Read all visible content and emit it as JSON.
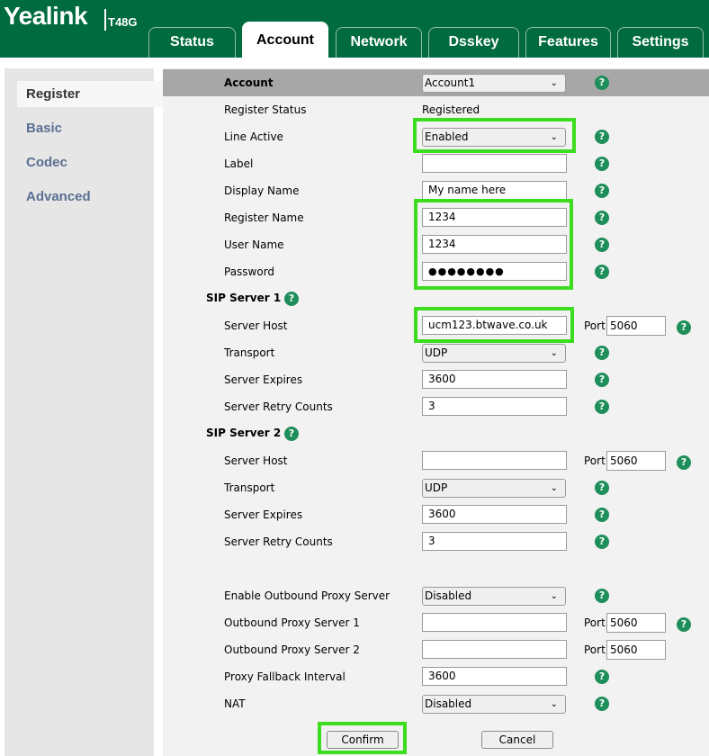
{
  "header": {
    "brand": "Yealink",
    "model": "T48G",
    "tabs": [
      {
        "label": "Status"
      },
      {
        "label": "Account"
      },
      {
        "label": "Network"
      },
      {
        "label": "Dsskey"
      },
      {
        "label": "Features"
      },
      {
        "label": "Settings"
      }
    ],
    "active_tab": "Account"
  },
  "sidebar": {
    "items": [
      {
        "label": "Register"
      },
      {
        "label": "Basic"
      },
      {
        "label": "Codec"
      },
      {
        "label": "Advanced"
      }
    ],
    "active_item": "Register"
  },
  "form": {
    "account": {
      "label": "Account",
      "value": "Account1"
    },
    "register_status": {
      "label": "Register Status",
      "value": "Registered"
    },
    "line_active": {
      "label": "Line Active",
      "value": "Enabled"
    },
    "label": {
      "label": "Label",
      "value": ""
    },
    "display_name": {
      "label": "Display Name",
      "value": "My name here"
    },
    "register_name": {
      "label": "Register Name",
      "value": "1234"
    },
    "user_name": {
      "label": "User Name",
      "value": "1234"
    },
    "password": {
      "label": "Password",
      "value": "●●●●●●●●"
    },
    "sip1": {
      "title": "SIP Server 1",
      "server_host": {
        "label": "Server Host",
        "value": "ucm123.btwave.co.uk"
      },
      "port": {
        "label": "Port",
        "value": "5060"
      },
      "transport": {
        "label": "Transport",
        "value": "UDP"
      },
      "expires": {
        "label": "Server Expires",
        "value": "3600"
      },
      "retry": {
        "label": "Server Retry Counts",
        "value": "3"
      }
    },
    "sip2": {
      "title": "SIP Server 2",
      "server_host": {
        "label": "Server Host",
        "value": ""
      },
      "port": {
        "label": "Port",
        "value": "5060"
      },
      "transport": {
        "label": "Transport",
        "value": "UDP"
      },
      "expires": {
        "label": "Server Expires",
        "value": "3600"
      },
      "retry": {
        "label": "Server Retry Counts",
        "value": "3"
      }
    },
    "outbound_enable": {
      "label": "Enable Outbound Proxy Server",
      "value": "Disabled"
    },
    "outbound1": {
      "label": "Outbound Proxy Server 1",
      "value": "",
      "port_label": "Port",
      "port": "5060"
    },
    "outbound2": {
      "label": "Outbound Proxy Server 2",
      "value": "",
      "port_label": "Port",
      "port": "5060"
    },
    "fallback": {
      "label": "Proxy Fallback Interval",
      "value": "3600"
    },
    "nat": {
      "label": "NAT",
      "value": "Disabled"
    },
    "help_glyph": "?",
    "dropdown_icon": "chevron-down-icon"
  },
  "buttons": {
    "confirm": "Confirm",
    "cancel": "Cancel"
  },
  "colors": {
    "header": "#006b3f",
    "highlight": "#3cdc1e",
    "help": "#1e8e5a",
    "sidebar_link": "#5b6f93"
  }
}
